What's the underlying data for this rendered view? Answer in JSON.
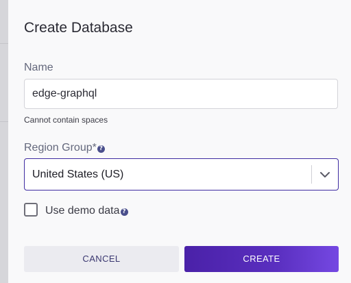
{
  "dialog": {
    "title": "Create Database"
  },
  "name_field": {
    "label": "Name",
    "value": "edge-graphql",
    "hint": "Cannot contain spaces"
  },
  "region_field": {
    "label": "Region Group*",
    "help_icon_glyph": "?",
    "selected": "United States (US)",
    "chevron_icon": "chevron-down-icon"
  },
  "demo_data": {
    "label": "Use demo data",
    "checked": false,
    "help_icon_glyph": "?"
  },
  "actions": {
    "cancel_label": "CANCEL",
    "create_label": "CREATE"
  },
  "colors": {
    "accent": "#4a21a8",
    "accent_end": "#7548e2",
    "select_border": "#3d2aa0",
    "help_icon": "#4a4f8c"
  }
}
